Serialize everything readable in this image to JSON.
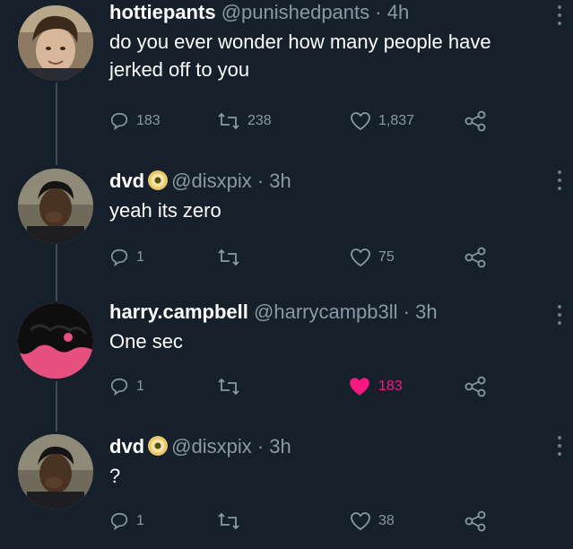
{
  "tweets": [
    {
      "name": "hottiepants",
      "handle": "@punishedpants",
      "time": "· 4h",
      "verified": false,
      "text": "do you ever wonder how many people have jerked off to you",
      "replies": "183",
      "retweets": "238",
      "likes": "1,837",
      "liked": false
    },
    {
      "name": "dvd",
      "handle": "@disxpix",
      "time": "· 3h",
      "verified": true,
      "text": "yeah its zero",
      "replies": "1",
      "retweets": "",
      "likes": "75",
      "liked": false
    },
    {
      "name": "harry.campbell",
      "handle": "@harrycampb3ll",
      "time": "· 3h",
      "verified": false,
      "text": "One sec",
      "replies": "1",
      "retweets": "",
      "likes": "183",
      "liked": true
    },
    {
      "name": "dvd",
      "handle": "@disxpix",
      "time": "· 3h",
      "verified": true,
      "text": "?",
      "replies": "1",
      "retweets": "",
      "likes": "38",
      "liked": false
    }
  ],
  "colors": {
    "background": "#15202b",
    "muted": "#8b98a5",
    "like_active": "#f91880",
    "thread_line": "#3d4a57"
  },
  "icons": [
    "reply-icon",
    "retweet-icon",
    "like-icon",
    "share-icon",
    "more-options-icon",
    "verified-badge-icon"
  ]
}
